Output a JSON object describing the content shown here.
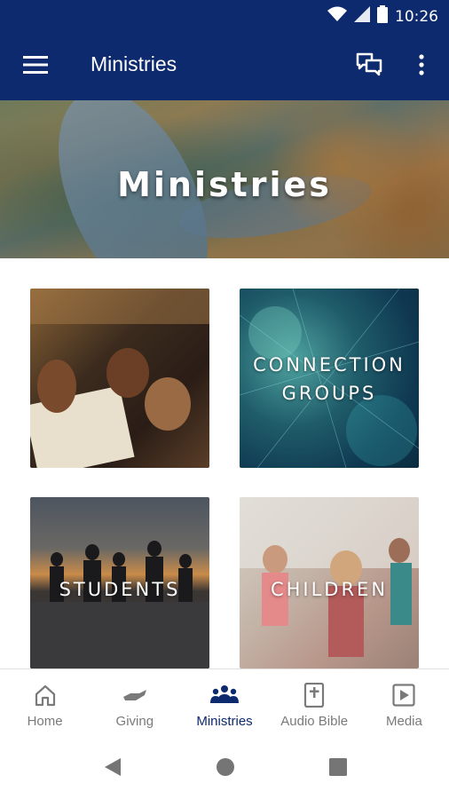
{
  "status_bar": {
    "time": "10:26",
    "icons": [
      "wifi-icon",
      "signal-icon",
      "battery-icon"
    ]
  },
  "app_bar": {
    "title": "Ministries",
    "icons": [
      "menu-icon",
      "chat-icon",
      "more-vert-icon"
    ]
  },
  "hero": {
    "title": "Ministries"
  },
  "tiles": [
    {
      "label": ""
    },
    {
      "label_line1": "CONNECTION",
      "label_line2": "GROUPS"
    },
    {
      "label": "STUDENTS"
    },
    {
      "label": "CHILDREN"
    }
  ],
  "bottom_nav": {
    "items": [
      {
        "label": "Home",
        "icon": "home-icon"
      },
      {
        "label": "Giving",
        "icon": "giving-hand-icon"
      },
      {
        "label": "Ministries",
        "icon": "group-icon",
        "active": true
      },
      {
        "label": "Audio Bible",
        "icon": "bible-icon"
      },
      {
        "label": "Media",
        "icon": "play-icon"
      }
    ]
  },
  "colors": {
    "primary": "#0d2a6e",
    "inactive": "#7a7a7a",
    "system_nav": "#757575"
  }
}
